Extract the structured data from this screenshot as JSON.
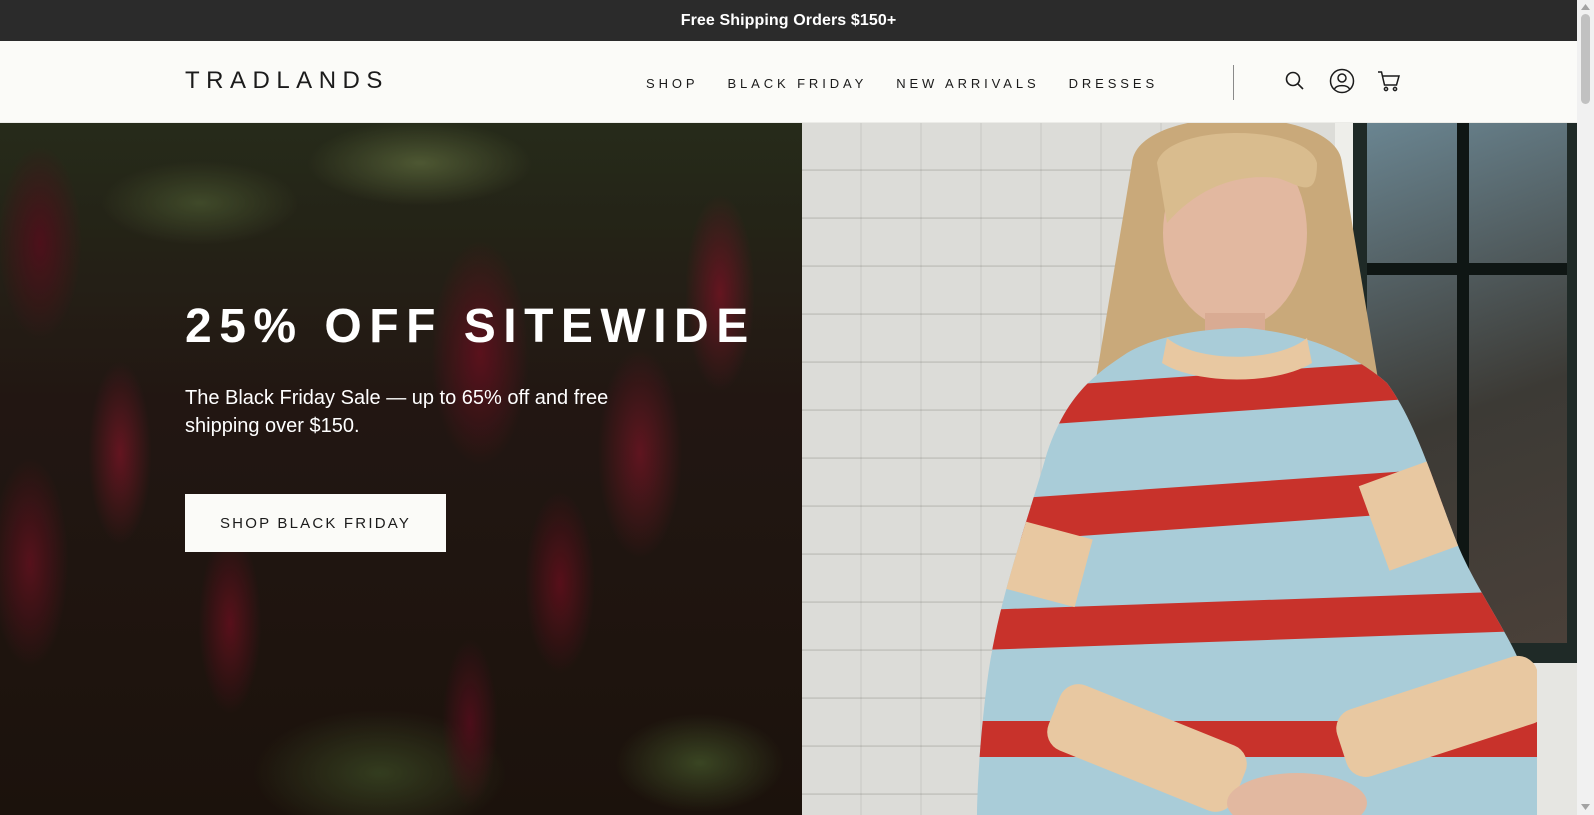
{
  "announcement": {
    "text": "Free Shipping Orders $150+"
  },
  "header": {
    "logo": "TRADLANDS",
    "nav": [
      {
        "label": "SHOP"
      },
      {
        "label": "BLACK FRIDAY"
      },
      {
        "label": "NEW ARRIVALS"
      },
      {
        "label": "DRESSES"
      }
    ],
    "icons": [
      "search-icon",
      "account-icon",
      "cart-icon"
    ]
  },
  "hero": {
    "title": "25% OFF SITEWIDE",
    "subtitle": "The Black Friday Sale — up to 65% off and free shipping over $150.",
    "cta_label": "SHOP BLACK FRIDAY"
  },
  "colors": {
    "announcement_bg": "#2b2b2b",
    "header_bg": "#fbfbf8",
    "text_dark": "#1b1b1b",
    "cta_bg": "#fbfbf8"
  }
}
